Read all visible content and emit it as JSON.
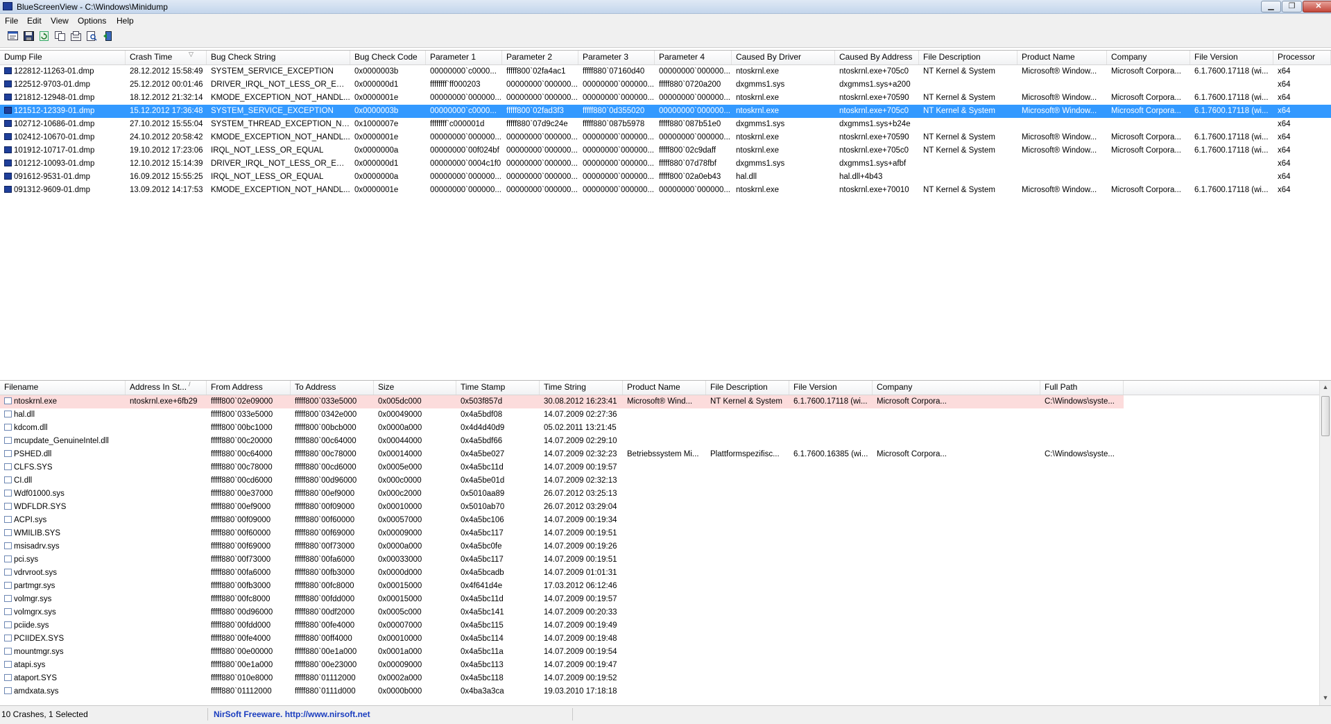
{
  "window": {
    "title": "BlueScreenView  -  C:\\Windows\\Minidump",
    "minimize": "▁",
    "restore": "❐",
    "close": "✕"
  },
  "menu": [
    "File",
    "Edit",
    "View",
    "Options",
    "Help"
  ],
  "toolbar_icons": [
    "properties-icon",
    "save-icon",
    "refresh-icon",
    "copy-icon",
    "report-icon",
    "find-icon",
    "exit-icon"
  ],
  "crash_columns": [
    "Dump File",
    "Crash Time",
    "Bug Check String",
    "Bug Check Code",
    "Parameter 1",
    "Parameter 2",
    "Parameter 3",
    "Parameter 4",
    "Caused By Driver",
    "Caused By Address",
    "File Description",
    "Product Name",
    "Company",
    "File Version",
    "Processor"
  ],
  "crash_rows": [
    [
      "122812-11263-01.dmp",
      "28.12.2012 15:58:49",
      "SYSTEM_SERVICE_EXCEPTION",
      "0x0000003b",
      "00000000`c0000...",
      "fffff800`02fa4ac1",
      "fffff880`07160d40",
      "00000000`000000...",
      "ntoskrnl.exe",
      "ntoskrnl.exe+705c0",
      "NT Kernel & System",
      "Microsoft® Window...",
      "Microsoft Corpora...",
      "6.1.7600.17118 (wi...",
      "x64"
    ],
    [
      "122512-9703-01.dmp",
      "25.12.2012 00:01:46",
      "DRIVER_IRQL_NOT_LESS_OR_EQUAL",
      "0x000000d1",
      "ffffffff`ff000203",
      "00000000`000000...",
      "00000000`000000...",
      "fffff880`0720a200",
      "dxgmms1.sys",
      "dxgmms1.sys+a200",
      "",
      "",
      "",
      "",
      "x64"
    ],
    [
      "121812-12948-01.dmp",
      "18.12.2012 21:32:14",
      "KMODE_EXCEPTION_NOT_HANDL...",
      "0x0000001e",
      "00000000`000000...",
      "00000000`000000...",
      "00000000`000000...",
      "00000000`000000...",
      "ntoskrnl.exe",
      "ntoskrnl.exe+70590",
      "NT Kernel & System",
      "Microsoft® Window...",
      "Microsoft Corpora...",
      "6.1.7600.17118 (wi...",
      "x64"
    ],
    [
      "121512-12339-01.dmp",
      "15.12.2012 17:36:48",
      "SYSTEM_SERVICE_EXCEPTION",
      "0x0000003b",
      "00000000`c0000...",
      "fffff800`02fad3f3",
      "fffff880`0d355020",
      "00000000`000000...",
      "ntoskrnl.exe",
      "ntoskrnl.exe+705c0",
      "NT Kernel & System",
      "Microsoft® Window...",
      "Microsoft Corpora...",
      "6.1.7600.17118 (wi...",
      "x64"
    ],
    [
      "102712-10686-01.dmp",
      "27.10.2012 15:55:04",
      "SYSTEM_THREAD_EXCEPTION_NO...",
      "0x1000007e",
      "ffffffff`c000001d",
      "fffff880`07d9c24e",
      "fffff880`087b5978",
      "fffff880`087b51e0",
      "dxgmms1.sys",
      "dxgmms1.sys+b24e",
      "",
      "",
      "",
      "",
      "x64"
    ],
    [
      "102412-10670-01.dmp",
      "24.10.2012 20:58:42",
      "KMODE_EXCEPTION_NOT_HANDL...",
      "0x0000001e",
      "00000000`000000...",
      "00000000`000000...",
      "00000000`000000...",
      "00000000`000000...",
      "ntoskrnl.exe",
      "ntoskrnl.exe+70590",
      "NT Kernel & System",
      "Microsoft® Window...",
      "Microsoft Corpora...",
      "6.1.7600.17118 (wi...",
      "x64"
    ],
    [
      "101912-10717-01.dmp",
      "19.10.2012 17:23:06",
      "IRQL_NOT_LESS_OR_EQUAL",
      "0x0000000a",
      "00000000`00f024bf",
      "00000000`000000...",
      "00000000`000000...",
      "fffff800`02c9daff",
      "ntoskrnl.exe",
      "ntoskrnl.exe+705c0",
      "NT Kernel & System",
      "Microsoft® Window...",
      "Microsoft Corpora...",
      "6.1.7600.17118 (wi...",
      "x64"
    ],
    [
      "101212-10093-01.dmp",
      "12.10.2012 15:14:39",
      "DRIVER_IRQL_NOT_LESS_OR_EQUAL",
      "0x000000d1",
      "00000000`0004c1f0",
      "00000000`000000...",
      "00000000`000000...",
      "fffff880`07d78fbf",
      "dxgmms1.sys",
      "dxgmms1.sys+afbf",
      "",
      "",
      "",
      "",
      "x64"
    ],
    [
      "091612-9531-01.dmp",
      "16.09.2012 15:55:25",
      "IRQL_NOT_LESS_OR_EQUAL",
      "0x0000000a",
      "00000000`000000...",
      "00000000`000000...",
      "00000000`000000...",
      "fffff800`02a0eb43",
      "hal.dll",
      "hal.dll+4b43",
      "",
      "",
      "",
      "",
      "x64"
    ],
    [
      "091312-9609-01.dmp",
      "13.09.2012 14:17:53",
      "KMODE_EXCEPTION_NOT_HANDL...",
      "0x0000001e",
      "00000000`000000...",
      "00000000`000000...",
      "00000000`000000...",
      "00000000`000000...",
      "ntoskrnl.exe",
      "ntoskrnl.exe+70010",
      "NT Kernel & System",
      "Microsoft® Window...",
      "Microsoft Corpora...",
      "6.1.7600.17118 (wi...",
      "x64"
    ]
  ],
  "driver_columns": [
    "Filename",
    "Address In St...",
    "From Address",
    "To Address",
    "Size",
    "Time Stamp",
    "Time String",
    "Product Name",
    "File Description",
    "File Version",
    "Company",
    "Full Path"
  ],
  "driver_rows": [
    [
      "ntoskrnl.exe",
      "ntoskrnl.exe+6fb29",
      "fffff800`02e09000",
      "fffff800`033e5000",
      "0x005dc000",
      "0x503f857d",
      "30.08.2012 16:23:41",
      "Microsoft® Wind...",
      "NT Kernel & System",
      "6.1.7600.17118 (wi...",
      "Microsoft Corpora...",
      "C:\\Windows\\syste..."
    ],
    [
      "hal.dll",
      "",
      "fffff800`033e5000",
      "fffff800`0342e000",
      "0x00049000",
      "0x4a5bdf08",
      "14.07.2009 02:27:36",
      "",
      "",
      "",
      "",
      ""
    ],
    [
      "kdcom.dll",
      "",
      "fffff800`00bc1000",
      "fffff800`00bcb000",
      "0x0000a000",
      "0x4d4d40d9",
      "05.02.2011 13:21:45",
      "",
      "",
      "",
      "",
      ""
    ],
    [
      "mcupdate_GenuineIntel.dll",
      "",
      "fffff880`00c20000",
      "fffff880`00c64000",
      "0x00044000",
      "0x4a5bdf66",
      "14.07.2009 02:29:10",
      "",
      "",
      "",
      "",
      ""
    ],
    [
      "PSHED.dll",
      "",
      "fffff880`00c64000",
      "fffff880`00c78000",
      "0x00014000",
      "0x4a5be027",
      "14.07.2009 02:32:23",
      "Betriebssystem Mi...",
      "Plattformspezifisc...",
      "6.1.7600.16385 (wi...",
      "Microsoft Corpora...",
      "C:\\Windows\\syste..."
    ],
    [
      "CLFS.SYS",
      "",
      "fffff880`00c78000",
      "fffff880`00cd6000",
      "0x0005e000",
      "0x4a5bc11d",
      "14.07.2009 00:19:57",
      "",
      "",
      "",
      "",
      ""
    ],
    [
      "CI.dll",
      "",
      "fffff880`00cd6000",
      "fffff880`00d96000",
      "0x000c0000",
      "0x4a5be01d",
      "14.07.2009 02:32:13",
      "",
      "",
      "",
      "",
      ""
    ],
    [
      "Wdf01000.sys",
      "",
      "fffff880`00e37000",
      "fffff880`00ef9000",
      "0x000c2000",
      "0x5010aa89",
      "26.07.2012 03:25:13",
      "",
      "",
      "",
      "",
      ""
    ],
    [
      "WDFLDR.SYS",
      "",
      "fffff880`00ef9000",
      "fffff880`00f09000",
      "0x00010000",
      "0x5010ab70",
      "26.07.2012 03:29:04",
      "",
      "",
      "",
      "",
      ""
    ],
    [
      "ACPI.sys",
      "",
      "fffff880`00f09000",
      "fffff880`00f60000",
      "0x00057000",
      "0x4a5bc106",
      "14.07.2009 00:19:34",
      "",
      "",
      "",
      "",
      ""
    ],
    [
      "WMILIB.SYS",
      "",
      "fffff880`00f60000",
      "fffff880`00f69000",
      "0x00009000",
      "0x4a5bc117",
      "14.07.2009 00:19:51",
      "",
      "",
      "",
      "",
      ""
    ],
    [
      "msisadrv.sys",
      "",
      "fffff880`00f69000",
      "fffff880`00f73000",
      "0x0000a000",
      "0x4a5bc0fe",
      "14.07.2009 00:19:26",
      "",
      "",
      "",
      "",
      ""
    ],
    [
      "pci.sys",
      "",
      "fffff880`00f73000",
      "fffff880`00fa6000",
      "0x00033000",
      "0x4a5bc117",
      "14.07.2009 00:19:51",
      "",
      "",
      "",
      "",
      ""
    ],
    [
      "vdrvroot.sys",
      "",
      "fffff880`00fa6000",
      "fffff880`00fb3000",
      "0x0000d000",
      "0x4a5bcadb",
      "14.07.2009 01:01:31",
      "",
      "",
      "",
      "",
      ""
    ],
    [
      "partmgr.sys",
      "",
      "fffff880`00fb3000",
      "fffff880`00fc8000",
      "0x00015000",
      "0x4f641d4e",
      "17.03.2012 06:12:46",
      "",
      "",
      "",
      "",
      ""
    ],
    [
      "volmgr.sys",
      "",
      "fffff880`00fc8000",
      "fffff880`00fdd000",
      "0x00015000",
      "0x4a5bc11d",
      "14.07.2009 00:19:57",
      "",
      "",
      "",
      "",
      ""
    ],
    [
      "volmgrx.sys",
      "",
      "fffff880`00d96000",
      "fffff880`00df2000",
      "0x0005c000",
      "0x4a5bc141",
      "14.07.2009 00:20:33",
      "",
      "",
      "",
      "",
      ""
    ],
    [
      "pciide.sys",
      "",
      "fffff880`00fdd000",
      "fffff880`00fe4000",
      "0x00007000",
      "0x4a5bc115",
      "14.07.2009 00:19:49",
      "",
      "",
      "",
      "",
      ""
    ],
    [
      "PCIIDEX.SYS",
      "",
      "fffff880`00fe4000",
      "fffff880`00ff4000",
      "0x00010000",
      "0x4a5bc114",
      "14.07.2009 00:19:48",
      "",
      "",
      "",
      "",
      ""
    ],
    [
      "mountmgr.sys",
      "",
      "fffff880`00e00000",
      "fffff880`00e1a000",
      "0x0001a000",
      "0x4a5bc11a",
      "14.07.2009 00:19:54",
      "",
      "",
      "",
      "",
      ""
    ],
    [
      "atapi.sys",
      "",
      "fffff880`00e1a000",
      "fffff880`00e23000",
      "0x00009000",
      "0x4a5bc113",
      "14.07.2009 00:19:47",
      "",
      "",
      "",
      "",
      ""
    ],
    [
      "ataport.SYS",
      "",
      "fffff880`010e8000",
      "fffff880`01112000",
      "0x0002a000",
      "0x4a5bc118",
      "14.07.2009 00:19:52",
      "",
      "",
      "",
      "",
      ""
    ],
    [
      "amdxata.sys",
      "",
      "fffff880`01112000",
      "fffff880`0111d000",
      "0x0000b000",
      "0x4ba3a3ca",
      "19.03.2010 17:18:18",
      "",
      "",
      "",
      "",
      ""
    ]
  ],
  "status": {
    "count_text": "10 Crashes, 1 Selected",
    "nirsoft_text": "NirSoft Freeware.  http://www.nirsoft.net"
  }
}
